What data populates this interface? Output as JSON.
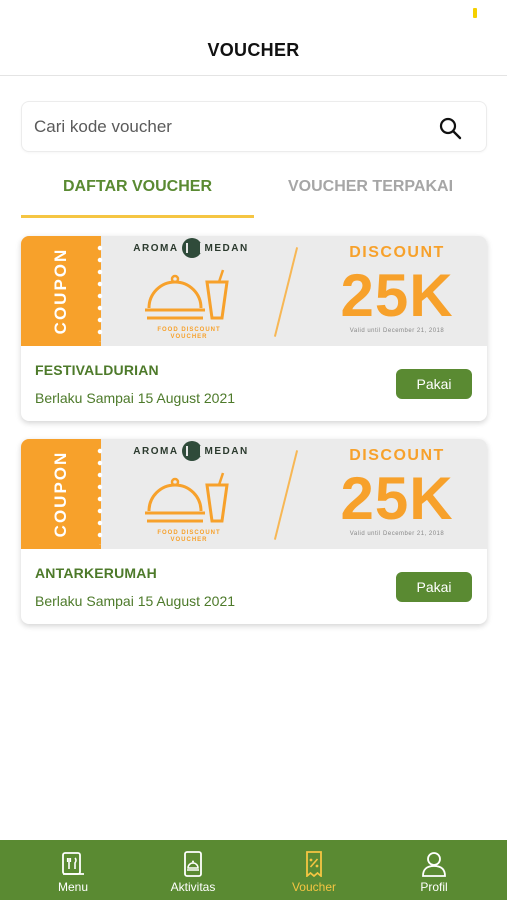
{
  "header": {
    "title": "VOUCHER"
  },
  "search": {
    "placeholder": "Cari kode voucher",
    "value": ""
  },
  "tabs": [
    {
      "label": "DAFTAR VOUCHER",
      "active": true
    },
    {
      "label": "VOUCHER TERPAKAI",
      "active": false
    }
  ],
  "vouchers": [
    {
      "banner": {
        "coupon": "COUPON",
        "brand_left": "AROMA",
        "brand_right": "MEDAN",
        "food_caption": "FOOD DISCOUNT VOUCHER",
        "discount": "DISCOUNT",
        "amount": "25K",
        "valid": "Valid until December 21, 2018"
      },
      "code": "FESTIVALDURIAN",
      "validity": "Berlaku Sampai 15 August 2021",
      "button": "Pakai"
    },
    {
      "banner": {
        "coupon": "COUPON",
        "brand_left": "AROMA",
        "brand_right": "MEDAN",
        "food_caption": "FOOD DISCOUNT VOUCHER",
        "discount": "DISCOUNT",
        "amount": "25K",
        "valid": "Valid until December 21, 2018"
      },
      "code": "ANTARKERUMAH",
      "validity": "Berlaku Sampai 15 August 2021",
      "button": "Pakai"
    }
  ],
  "nav": [
    {
      "label": "Menu",
      "icon": "menu-icon",
      "active": false
    },
    {
      "label": "Aktivitas",
      "icon": "activity-icon",
      "active": false
    },
    {
      "label": "Voucher",
      "icon": "voucher-icon",
      "active": true
    },
    {
      "label": "Profil",
      "icon": "profile-icon",
      "active": false
    }
  ],
  "colors": {
    "primary_green": "#5a8a32",
    "accent_orange": "#f7a12b",
    "tab_underline": "#f5c542",
    "active_nav": "#f5c542"
  }
}
